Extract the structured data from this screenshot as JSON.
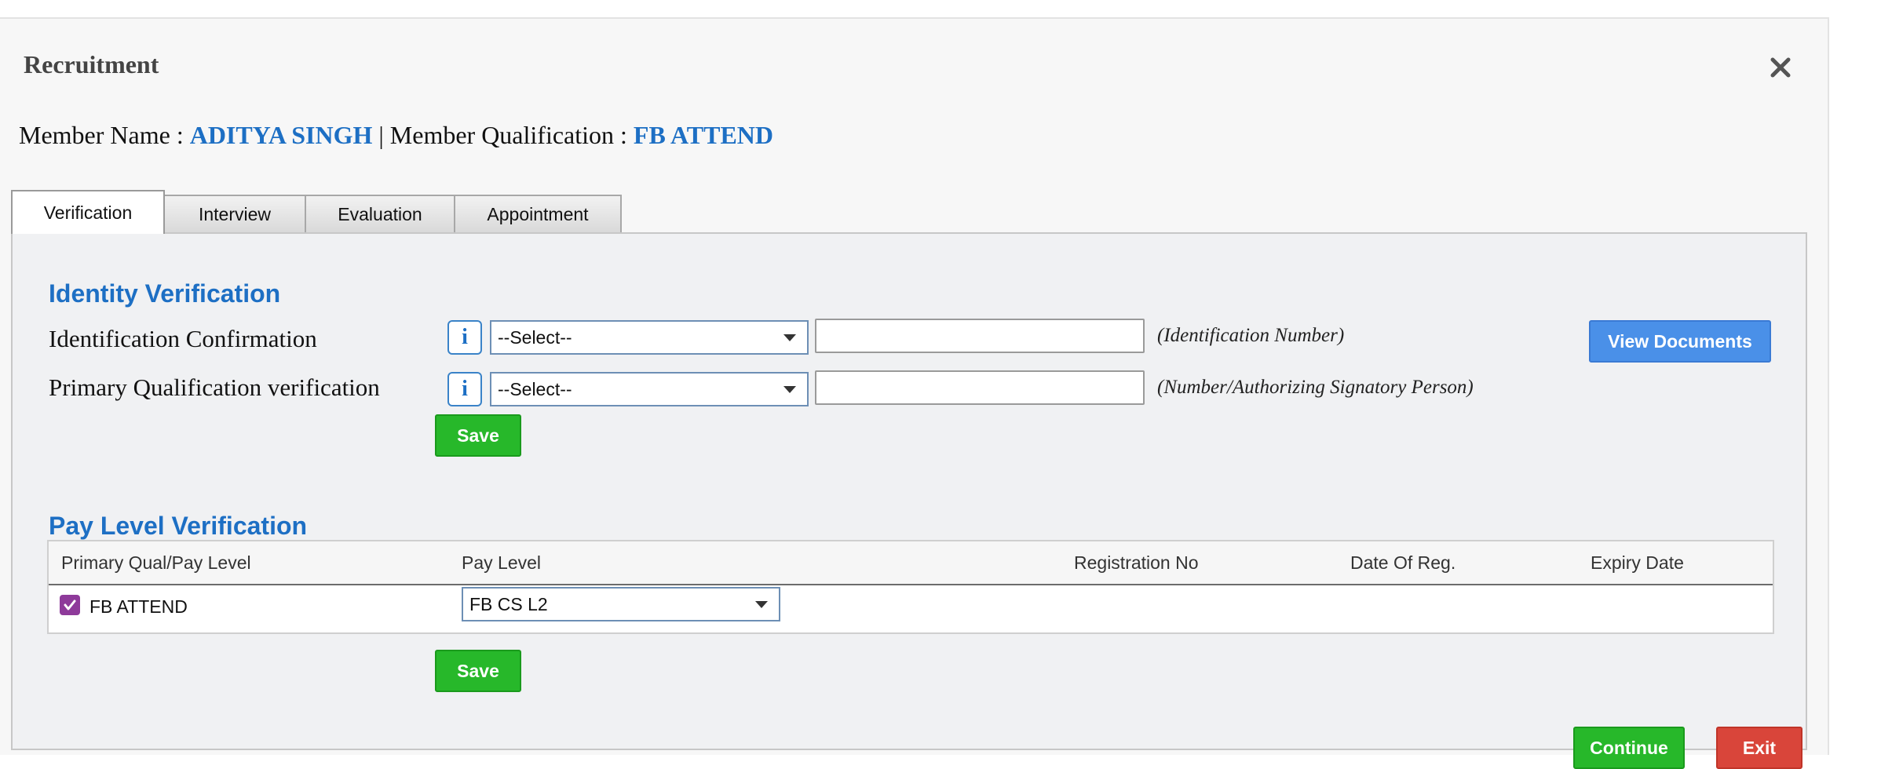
{
  "modal": {
    "title": "Recruitment",
    "close_icon": "close-icon"
  },
  "member": {
    "name_label": "Member Name : ",
    "name_value": "ADITYA SINGH",
    "separator": " | ",
    "qual_label": "Member Qualification : ",
    "qual_value": "FB ATTEND"
  },
  "tabs": [
    {
      "label": "Verification",
      "active": true
    },
    {
      "label": "Interview",
      "active": false
    },
    {
      "label": "Evaluation",
      "active": false
    },
    {
      "label": "Appointment",
      "active": false
    }
  ],
  "identity": {
    "title": "Identity Verification",
    "rows": [
      {
        "label": "Identification Confirmation",
        "info_icon": "info-icon",
        "select_value": "--Select--",
        "input_value": "",
        "hint": "(Identification Number)"
      },
      {
        "label": "Primary Qualification verification",
        "info_icon": "info-icon",
        "select_value": "--Select--",
        "input_value": "",
        "hint": "(Number/Authorizing Signatory Person)"
      }
    ],
    "view_documents_label": "View Documents",
    "save_label": "Save"
  },
  "pay_level": {
    "title": "Pay Level Verification",
    "columns": [
      "Primary Qual/Pay Level",
      "Pay Level",
      "Registration No",
      "Date Of Reg.",
      "Expiry Date"
    ],
    "rows": [
      {
        "checked": true,
        "qualification": "FB ATTEND",
        "pay_level": "FB CS L2",
        "registration_no": "",
        "date_of_reg": "",
        "expiry_date": ""
      }
    ],
    "save_label": "Save"
  },
  "footer": {
    "continue_label": "Continue",
    "exit_label": "Exit"
  },
  "colors": {
    "accent_blue": "#1d6fc4",
    "save_green": "#27b82a",
    "view_docs_blue": "#4a90e8",
    "exit_red": "#d9453a",
    "checkbox_purple": "#8e3a9a"
  }
}
